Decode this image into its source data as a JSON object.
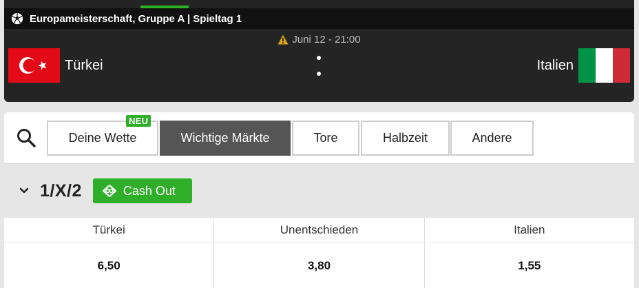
{
  "match": {
    "competition": "Europameisterschaft, Gruppe A | Spieltag 1",
    "kickoff": "Juni 12  -  21:00",
    "home_team": "Türkei",
    "away_team": "Italien",
    "score_separator": ":",
    "icons": {
      "competition": "soccer-ball-icon",
      "kickoff": "warning-icon"
    },
    "colors": {
      "active_accent": "#2fae29",
      "turkey_red": "#e30a17",
      "italy_green": "#009246",
      "italy_red": "#ce2b37"
    }
  },
  "filters": {
    "badge_new": "NEU",
    "tabs": [
      {
        "label": "Deine Wette",
        "active": false
      },
      {
        "label": "Wichtige Märkte",
        "active": true
      },
      {
        "label": "Tore",
        "active": false
      },
      {
        "label": "Halbzeit",
        "active": false
      },
      {
        "label": "Andere",
        "active": false
      }
    ]
  },
  "market": {
    "title": "1/X/2",
    "cash_out_label": "Cash Out",
    "outcomes": [
      {
        "label": "Türkei",
        "odds": "6,50"
      },
      {
        "label": "Unentschieden",
        "odds": "3,80"
      },
      {
        "label": "Italien",
        "odds": "1,55"
      }
    ]
  }
}
